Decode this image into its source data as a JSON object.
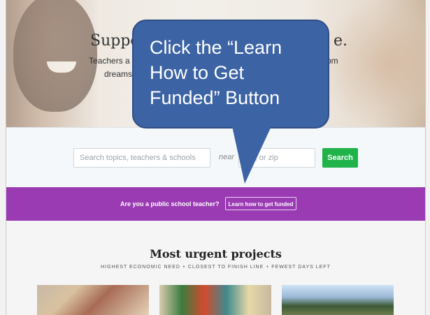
{
  "hero": {
    "title_left": "Suppo",
    "title_right": "e.",
    "subtitle_left": "Teachers a",
    "subtitle_left2": "dreams",
    "subtitle_right": "om"
  },
  "search": {
    "topics_placeholder": "Search topics, teachers & schools",
    "near_label": "near",
    "location_placeholder": "c     e, or zip",
    "button_label": "Search"
  },
  "teacher_banner": {
    "question": "Are you a public school teacher?",
    "cta_label": "Learn how to get funded"
  },
  "urgent": {
    "title": "Most urgent projects",
    "subtitle": "HIGHEST ECONOMIC NEED + CLOSEST TO FINISH LINE + FEWEST DAYS LEFT"
  },
  "callout": {
    "line1": "Click the “Learn",
    "line2": "How to Get",
    "line3": "Funded” Button",
    "color": "#3c63a4"
  },
  "colors": {
    "purple": "#9b3bb4",
    "search_green": "#1fb34a"
  }
}
